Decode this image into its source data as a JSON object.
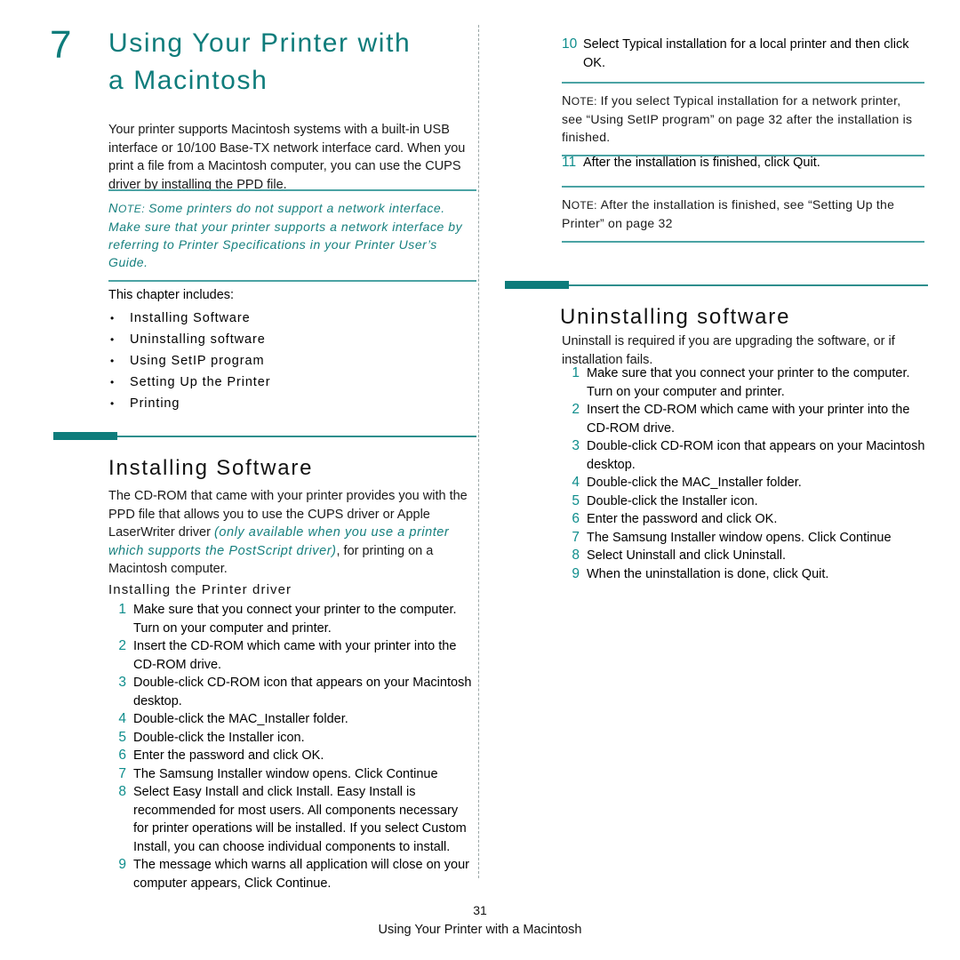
{
  "chapter": {
    "number": "7",
    "title_line1": "Using Your Printer with",
    "title_line2": "a Macintosh"
  },
  "intro": {
    "paragraph": "Your printer supports Macintosh systems with a built-in USB interface or 10/100 Base-TX network interface card. When you print a file from a Macintosh computer, you can use the CUPS driver by installing the PPD file."
  },
  "note_network": {
    "label": "NOTE:",
    "label_cap": "N",
    "label_rest": "OTE:",
    "text": "Some printers do not support a network interface. Make sure that your printer supports a network interface by referring to Printer Specifications in your Printer User’s Guide."
  },
  "includes": {
    "lead": "This chapter includes:",
    "items": [
      "Installing Software",
      "Uninstalling software",
      "Using SetIP program",
      "Setting Up the Printer",
      "Printing"
    ]
  },
  "section_installing": {
    "title": "Installing Software",
    "intro_a": "The CD-ROM that came with your printer provides you with the PPD file that allows you to use the CUPS driver or Apple LaserWriter driver ",
    "intro_em": "(only available when you use a printer which supports the PostScript driver)",
    "intro_b": ", for printing on a Macintosh computer.",
    "subheading": "Installing the Printer driver",
    "steps": [
      {
        "num": "1",
        "text": "Make sure that you connect your printer to the computer. Turn on your computer and printer."
      },
      {
        "num": "2",
        "text": "Insert the CD-ROM which came with your printer into the CD-ROM drive."
      },
      {
        "num": "3",
        "text": "Double-click CD-ROM icon that appears on your Macintosh desktop."
      },
      {
        "num": "4",
        "text": "Double-click the MAC_Installer folder."
      },
      {
        "num": "5",
        "text": "Double-click the Installer icon."
      },
      {
        "num": "6",
        "text": "Enter the password and click OK."
      },
      {
        "num": "7",
        "text": "The Samsung Installer window opens. Click Continue"
      },
      {
        "num": "8",
        "text": "Select Easy Install and click Install. Easy Install is recommended for most users. All components necessary for printer operations will be installed. If you select Custom Install, you can choose individual components to install."
      },
      {
        "num": "9",
        "text": "The message which warns all application will close on your computer appears, Click Continue."
      }
    ]
  },
  "right_steps_top": [
    {
      "num": "10",
      "text": "Select Typical installation for a local printer and then click OK."
    }
  ],
  "note_typical": {
    "label_cap": "N",
    "label_rest": "OTE:",
    "text": "If you select Typical installation for a network printer, see “Using SetIP program” on page 32 after the installation is finished."
  },
  "right_steps_mid": [
    {
      "num": "11",
      "text": "After the installation is finished, click Quit."
    }
  ],
  "note_setup": {
    "label_cap": "N",
    "label_rest": "OTE:",
    "text": "After the installation is finished, see “Setting Up the Printer” on page 32"
  },
  "section_uninstalling": {
    "title": "Uninstalling software",
    "intro": "Uninstall is required if you are upgrading the software, or if installation fails.",
    "steps": [
      {
        "num": "1",
        "text": "Make sure that you connect your printer to the computer. Turn on your computer and printer."
      },
      {
        "num": "2",
        "text": "Insert the CD-ROM which came with your printer into the CD-ROM drive."
      },
      {
        "num": "3",
        "text": "Double-click CD-ROM icon that appears on your Macintosh desktop."
      },
      {
        "num": "4",
        "text": "Double-click the MAC_Installer folder."
      },
      {
        "num": "5",
        "text": "Double-click the Installer icon."
      },
      {
        "num": "6",
        "text": "Enter the password and click OK."
      },
      {
        "num": "7",
        "text": "The Samsung Installer window opens. Click Continue"
      },
      {
        "num": "8",
        "text": "Select Uninstall and click Uninstall."
      },
      {
        "num": "9",
        "text": "When the uninstallation is done, click Quit."
      }
    ]
  },
  "footer": {
    "page_number": "31",
    "title": "Using Your Printer with a Macintosh"
  },
  "colors": {
    "teal_heading": "#0e7c7b",
    "teal_rule": "#2e8e8d",
    "teal_note_rule": "#4ba3a4",
    "teal_step_number": "#0e8d8c",
    "body_text": "#1a1a1a",
    "divider": "#9aa6a6"
  }
}
